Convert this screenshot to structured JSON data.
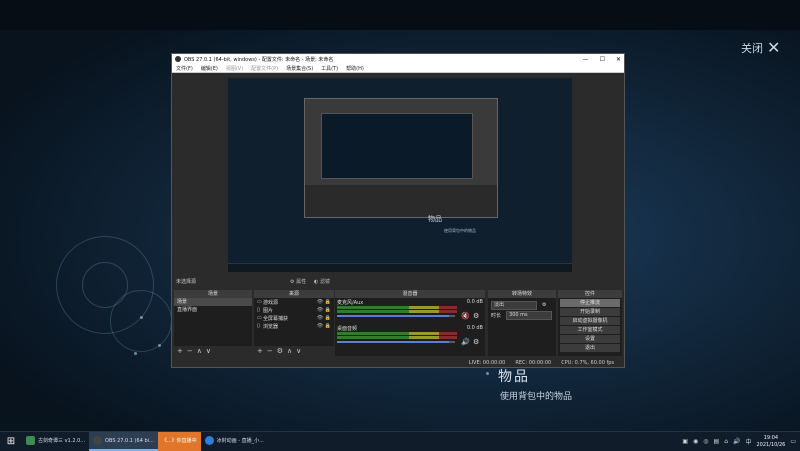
{
  "game": {
    "close_label": "关闭",
    "close_icon": "close-x-icon",
    "item_name": "物品",
    "item_desc": "使用背包中的物品"
  },
  "obs": {
    "title": "OBS 27.0.1 (64-bit, windows) - 配置文件: 未命名 - 场景: 未命名",
    "menu": [
      "文件(F)",
      "编辑(E)",
      "视图(V)",
      "配置文件(P)",
      "场景集合(S)",
      "工具(T)",
      "帮助(H)"
    ],
    "preview": {
      "item_name": "物品",
      "item_desc": "使用背包中的物品"
    },
    "no_source_selected": "未选择源",
    "properties_label": "属性",
    "filters_label": "滤镜",
    "docks": {
      "scenes": {
        "title": "场景",
        "items": [
          "场景",
          "直播界面"
        ]
      },
      "sources": {
        "title": "来源",
        "items": [
          {
            "icon": "monitor-icon",
            "label": "游戏源"
          },
          {
            "icon": "file-icon",
            "label": "图片"
          },
          {
            "icon": "monitor-icon",
            "label": "全屏幕捕获"
          },
          {
            "icon": "file-icon",
            "label": "浏览器"
          }
        ]
      },
      "mixer": {
        "title": "混音器",
        "tracks": [
          {
            "name": "麦克风/Aux",
            "db": "0.0 dB"
          },
          {
            "name": "桌面音频",
            "db": "0.0 dB"
          }
        ]
      },
      "transitions": {
        "title": "转场特效",
        "type": "淡出",
        "duration_label": "时长",
        "duration": "300 ms"
      },
      "controls": {
        "title": "控件",
        "buttons": [
          "停止推流",
          "开始录制",
          "启动虚拟摄像机",
          "工作室模式",
          "设置",
          "退出"
        ]
      }
    },
    "status": {
      "live": "LIVE: 00:00:00",
      "rec": "REC: 00:00:00",
      "cpu": "CPU: 0.7%, 60.00 fps"
    }
  },
  "taskbar": {
    "start_icon": "windows-logo-icon",
    "tasks": [
      {
        "label": "古剑奇谭三 v1.2.0...",
        "state": "normal"
      },
      {
        "label": "OBS 27.0.1 (64 bi...",
        "state": "active"
      },
      {
        "label": "《...》你直播中",
        "state": "orange"
      },
      {
        "label": "冰封动画 - 直播_小...",
        "state": "normal"
      }
    ],
    "time": "19:04",
    "date": "2021/10/26"
  }
}
